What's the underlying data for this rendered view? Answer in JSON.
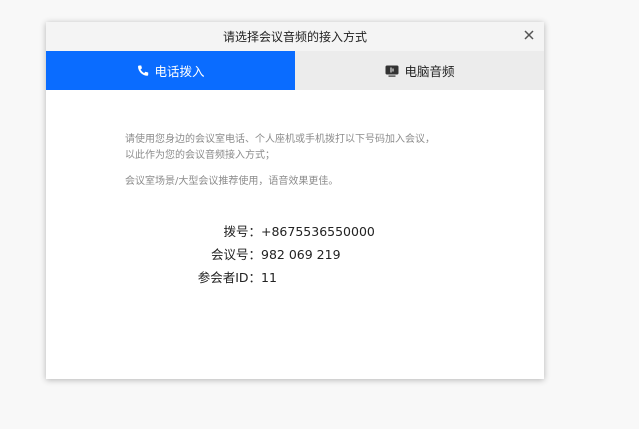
{
  "dialog": {
    "title": "请选择会议音频的接入方式",
    "close_icon": "close-icon"
  },
  "tabs": [
    {
      "label": "电话拨入",
      "icon": "phone-icon",
      "active": true
    },
    {
      "label": "电脑音频",
      "icon": "computer-audio-icon",
      "active": false
    }
  ],
  "description": {
    "line1": "请使用您身边的会议室电话、个人座机或手机拨打以下号码加入会议，",
    "line2": "以此作为您的会议音频接入方式；",
    "line3": "会议室场景/大型会议推荐使用，语音效果更佳。"
  },
  "info": {
    "dial_label": "拨号：",
    "dial_value": "+8675536550000",
    "meeting_label": "会议号：",
    "meeting_value": "982 069 219",
    "participant_label": "参会者ID：",
    "participant_value": "11"
  },
  "colors": {
    "accent": "#0a6cff",
    "inactive_tab": "#ececec",
    "desc_text": "#8c8c8c"
  }
}
